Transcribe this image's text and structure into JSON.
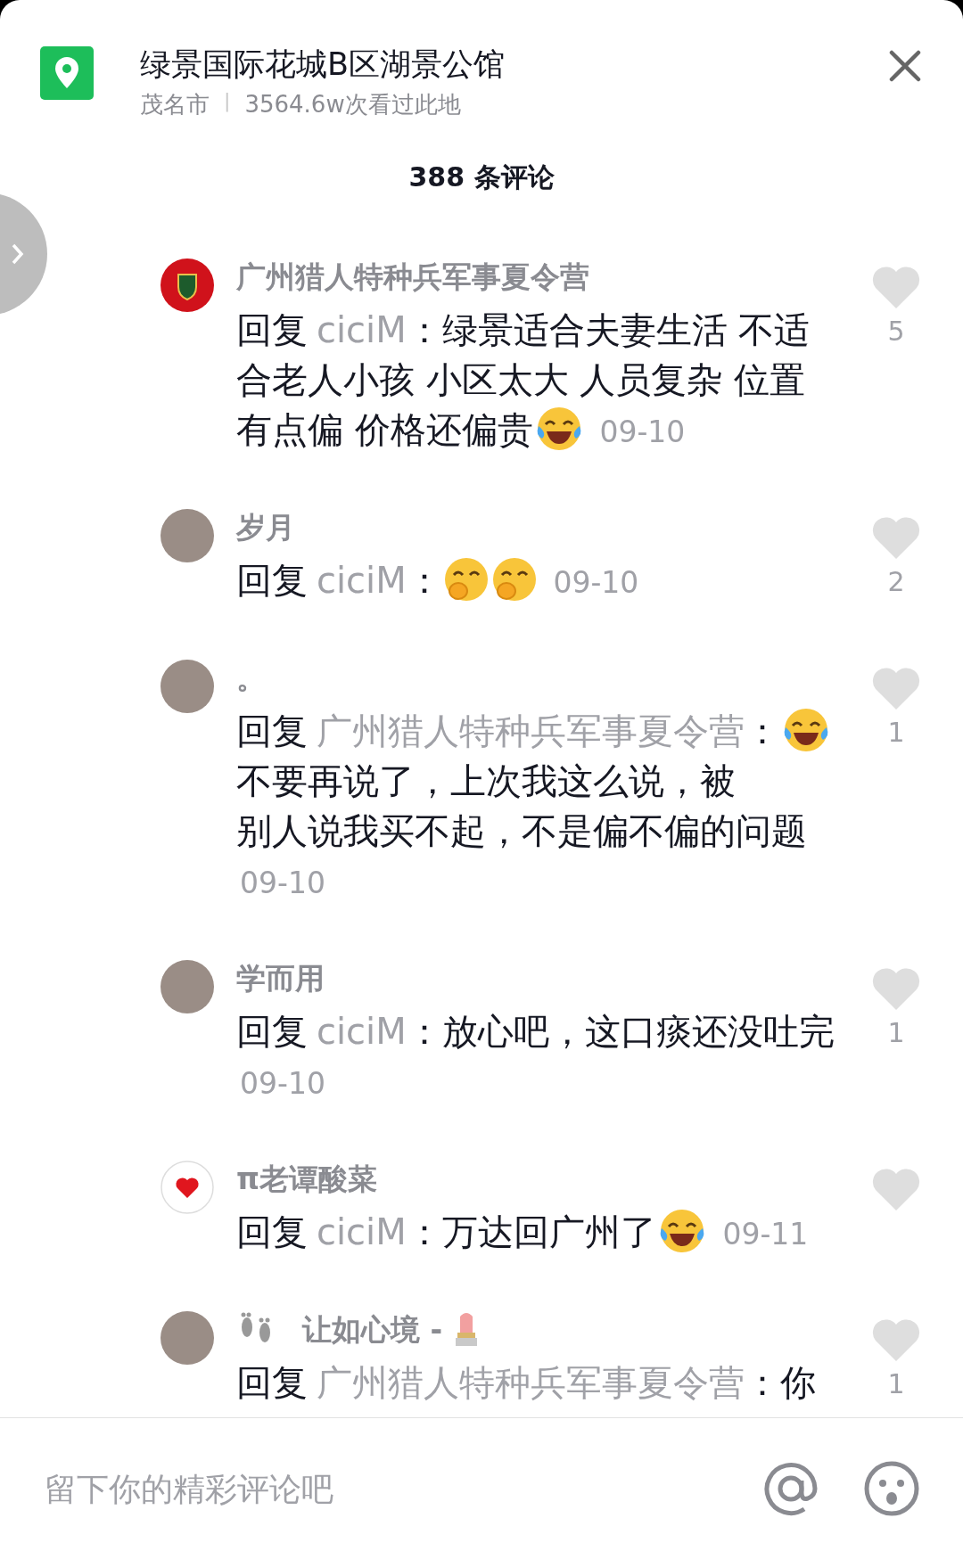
{
  "header": {
    "title": "绿景国际花城B区湖景公馆",
    "city": "茂名市",
    "separator": "|",
    "views": "3564.6w次看过此地"
  },
  "comment_count": "388 条评论",
  "comments": [
    {
      "avatar": {
        "kind": "badge"
      },
      "name": [
        {
          "kind": "text",
          "text": "广州猎人特种兵军事夏令营"
        }
      ],
      "body": [
        {
          "kind": "text",
          "text": "回复"
        },
        {
          "kind": "mention",
          "text": "ciciM"
        },
        {
          "kind": "text",
          "text": "：绿景适合夫妻生活 不适"
        },
        {
          "kind": "text",
          "text": "合老人小孩 小区太大 人员复杂 位置"
        },
        {
          "kind": "text",
          "text": "有点偏 价格还偏贵"
        },
        {
          "kind": "laugh"
        },
        {
          "kind": "date",
          "text": "09-10"
        }
      ],
      "likes": "5"
    },
    {
      "avatar": {
        "kind": "photo"
      },
      "name": [
        {
          "kind": "text",
          "text": "岁月"
        }
      ],
      "body": [
        {
          "kind": "text",
          "text": "回复"
        },
        {
          "kind": "mention",
          "text": "ciciM"
        },
        {
          "kind": "text",
          "text": "："
        },
        {
          "kind": "shy"
        },
        {
          "kind": "shy"
        },
        {
          "kind": "date",
          "text": "09-10"
        }
      ],
      "likes": "2"
    },
    {
      "avatar": {
        "kind": "photo"
      },
      "name": [
        {
          "kind": "text",
          "text": "。"
        }
      ],
      "body": [
        {
          "kind": "text",
          "text": "回复"
        },
        {
          "kind": "mention",
          "text": "广州猎人特种兵军事夏令营"
        },
        {
          "kind": "text",
          "text": "："
        },
        {
          "kind": "laugh"
        },
        {
          "kind": "text",
          "text": "不要再说了，上次我这么说，被"
        },
        {
          "kind": "text",
          "text": "别人说我买不起，不是偏不偏的问题"
        },
        {
          "kind": "date",
          "text": "09-10"
        }
      ],
      "likes": "1"
    },
    {
      "avatar": {
        "kind": "photo"
      },
      "name": [
        {
          "kind": "text",
          "text": "学而用"
        }
      ],
      "body": [
        {
          "kind": "text",
          "text": "回复"
        },
        {
          "kind": "mention",
          "text": "ciciM"
        },
        {
          "kind": "text",
          "text": "：放心吧，这口痰还没吐"
        },
        {
          "kind": "text",
          "text": "完"
        },
        {
          "kind": "date",
          "text": "09-10"
        }
      ],
      "likes": "1"
    },
    {
      "avatar": {
        "kind": "heart"
      },
      "name": [
        {
          "kind": "text",
          "text": "π老谭酸菜"
        }
      ],
      "body": [
        {
          "kind": "text",
          "text": "回复"
        },
        {
          "kind": "mention",
          "text": "ciciM"
        },
        {
          "kind": "text",
          "text": "：万达回广州了"
        },
        {
          "kind": "laugh"
        },
        {
          "kind": "date",
          "text": "09-11"
        }
      ]
    },
    {
      "avatar": {
        "kind": "photo"
      },
      "name": [
        {
          "kind": "feet"
        },
        {
          "kind": "text",
          "text": "让如心境 -"
        },
        {
          "kind": "lipstick"
        }
      ],
      "body": [
        {
          "kind": "text",
          "text": "回复"
        },
        {
          "kind": "mention",
          "text": "广州猎人特种兵军事夏令营"
        },
        {
          "kind": "text",
          "text": "：你"
        }
      ],
      "likes": "1"
    }
  ],
  "input": {
    "placeholder": "留下你的精彩评论吧"
  }
}
